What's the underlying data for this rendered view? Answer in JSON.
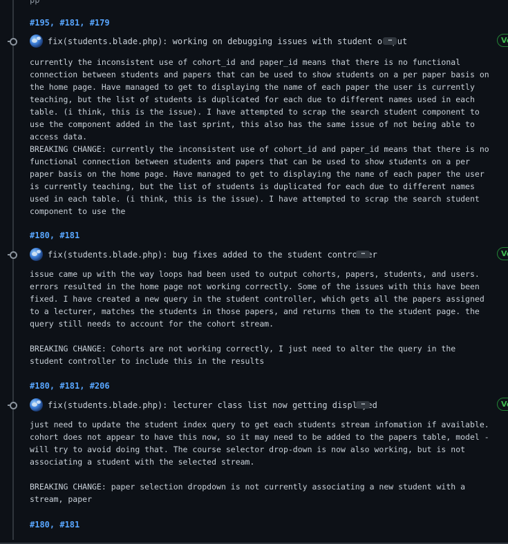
{
  "top_fragment": "pp",
  "commits": [
    {
      "refs_above": "#195, #181, #179",
      "title": "fix(students.blade.php): working on debugging issues with student output",
      "more_label": "…",
      "verified_label": "Ve",
      "body": "currently the inconsistent use of cohort_id and paper_id means that there is no functional connection between students and papers that can be used to show students on a per paper basis on the home page. Have managed to get to displaying the name of each paper the user is currently teaching, but the list of students is duplicated for each due to different names used in each table. (i think, this is the issue). I have attempted to scrap the search student component to use the component added in the last sprint, this also has the same issue of not being able to access data.",
      "breaking": "BREAKING CHANGE: currently the inconsistent use of cohort_id and paper_id means that there is no functional connection between students and papers that can be used to show students on a per paper basis on the home page. Have managed to get to displaying the name of each paper the user is currently teaching, but the list of students is duplicated for each due to different names used in each table. (i think, this is the issue). I have attempted to scrap the search student component to use the",
      "refs_below": "#180, #181"
    },
    {
      "title": "fix(students.blade.php): bug fixes added to the student controller",
      "more_label": "…",
      "verified_label": "Ve",
      "body": "issue came up with the way loops had been used to output cohorts, papers, students, and users. errors resulted in the home page not working correctly. Some of the issues with this have been fixed. I have created a new query in the student controller, which gets all the papers assigned to a lecturer, matches the students in those papers, and returns them to the student page. the query still needs to account for the cohort stream.",
      "breaking": "BREAKING CHANGE: Cohorts are not working correctly, I just need to alter the query in the student controller to include this in the results",
      "refs_below": "#180, #181, #206"
    },
    {
      "title": "fix(students.blade.php): lecturer class list now getting displayed",
      "more_label": "…",
      "verified_label": "Ve",
      "body": "just need to update the student index query to get each students stream infomation if available. cohort does not appear to have this now, so it may need to be added to the papers table, model - will try to avoid doing that. The course selector drop-down is now also working, but is not associating a student with the selected stream.",
      "breaking": "BREAKING CHANGE: paper selection dropdown is not currently associating a new student with a stream, paper",
      "refs_below": "#180, #181"
    }
  ]
}
